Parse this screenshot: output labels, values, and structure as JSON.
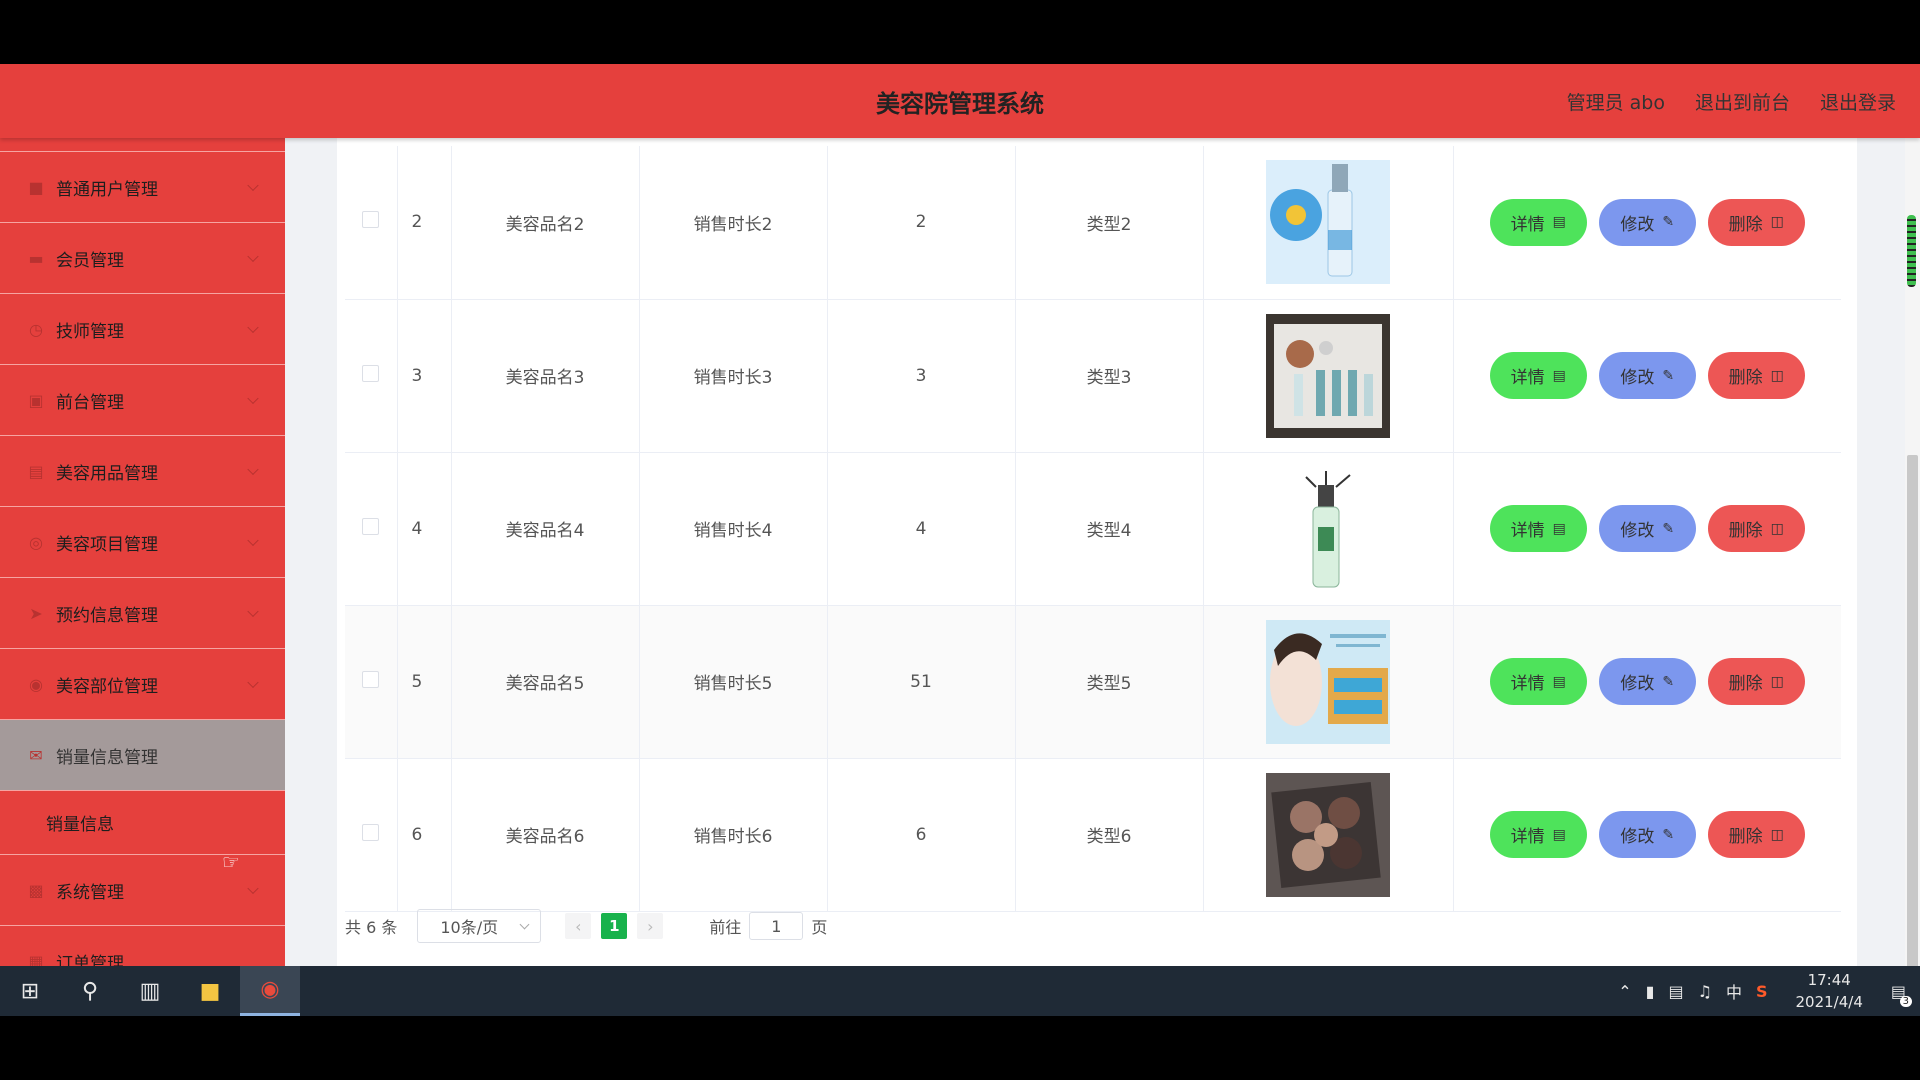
{
  "header": {
    "title": "美容院管理系统",
    "user": "管理员 abo",
    "front": "退出到前台",
    "logout": "退出登录"
  },
  "sidebar": {
    "items": [
      {
        "label": "普通用户管理",
        "icon": "user-icon"
      },
      {
        "label": "会员管理",
        "icon": "briefcase-icon"
      },
      {
        "label": "技师管理",
        "icon": "clock-icon"
      },
      {
        "label": "前台管理",
        "icon": "desk-icon"
      },
      {
        "label": "美容用品管理",
        "icon": "clipboard-icon"
      },
      {
        "label": "美容项目管理",
        "icon": "target-icon"
      },
      {
        "label": "预约信息管理",
        "icon": "send-icon"
      },
      {
        "label": "美容部位管理",
        "icon": "circle-icon"
      },
      {
        "label": "销量信息管理",
        "icon": "mail-icon",
        "active": true
      }
    ],
    "submenu": "销量信息",
    "after": [
      {
        "label": "系统管理",
        "icon": "chart-icon"
      },
      {
        "label": "订单管理",
        "icon": "order-icon"
      }
    ]
  },
  "table": {
    "rows": [
      {
        "idx": "2",
        "name": "美容品名2",
        "duration": "销售时长2",
        "qty": "2",
        "type": "类型2",
        "image": "serum-bottle"
      },
      {
        "idx": "3",
        "name": "美容品名3",
        "duration": "销售时长3",
        "qty": "3",
        "type": "类型3",
        "image": "gift-set"
      },
      {
        "idx": "4",
        "name": "美容品名4",
        "duration": "销售时长4",
        "qty": "4",
        "type": "类型4",
        "image": "clear-bottle"
      },
      {
        "idx": "5",
        "name": "美容品名5",
        "duration": "销售时长5",
        "qty": "51",
        "type": "类型5",
        "image": "face-mask"
      },
      {
        "idx": "6",
        "name": "美容品名6",
        "duration": "销售时长6",
        "qty": "6",
        "type": "类型6",
        "image": "eyeshadow"
      }
    ],
    "actions": {
      "detail": "详情",
      "edit": "修改",
      "delete": "删除"
    }
  },
  "pager": {
    "total": "共 6 条",
    "size": "10条/页",
    "current": "1",
    "goto": "前往",
    "goto_value": "1",
    "page": "页"
  },
  "taskbar": {
    "time": "17:44",
    "date": "2021/4/4",
    "ime": "中",
    "notifications": "3"
  },
  "colors": {
    "brand": "#e5403d",
    "detail": "#4ee35b",
    "edit": "#7c97ee",
    "delete": "#ed5655"
  }
}
